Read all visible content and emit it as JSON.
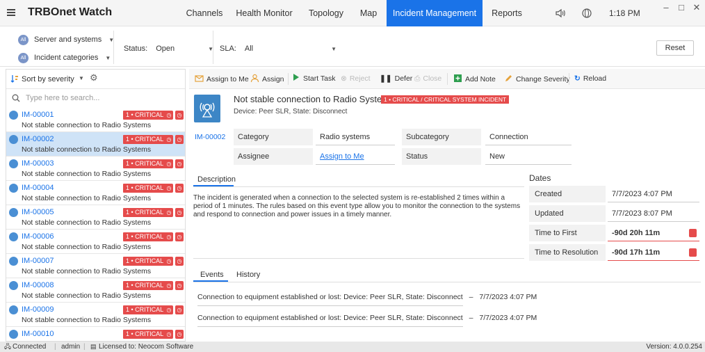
{
  "app": {
    "title": "TRBOnet Watch",
    "clock": "1:18 PM"
  },
  "nav": {
    "tabs": [
      {
        "label": "Channels"
      },
      {
        "label": "Health Monitor"
      },
      {
        "label": "Topology"
      },
      {
        "label": "Map"
      },
      {
        "label": "Incident Management"
      },
      {
        "label": "Reports"
      }
    ],
    "active": "Incident Management"
  },
  "filters": {
    "all_badge": "All",
    "scope_label": "Server and systems",
    "category_label": "Incident categories",
    "status_label": "Status:",
    "status_value": "Open",
    "sla_label": "SLA:",
    "sla_value": "All",
    "reset_label": "Reset"
  },
  "list": {
    "sort_label": "Sort by severity",
    "search_placeholder": "Type here to search...",
    "items": [
      {
        "id": "IM-00001",
        "severity": "1 • CRITICAL",
        "desc": "Not stable connection to Radio Systems"
      },
      {
        "id": "IM-00002",
        "severity": "1 • CRITICAL",
        "desc": "Not stable connection to Radio Systems"
      },
      {
        "id": "IM-00003",
        "severity": "1 • CRITICAL",
        "desc": "Not stable connection to Radio Systems"
      },
      {
        "id": "IM-00004",
        "severity": "1 • CRITICAL",
        "desc": "Not stable connection to Radio Systems"
      },
      {
        "id": "IM-00005",
        "severity": "1 • CRITICAL",
        "desc": "Not stable connection to Radio Systems"
      },
      {
        "id": "IM-00006",
        "severity": "1 • CRITICAL",
        "desc": "Not stable connection to Radio Systems"
      },
      {
        "id": "IM-00007",
        "severity": "1 • CRITICAL",
        "desc": "Not stable connection to Radio Systems"
      },
      {
        "id": "IM-00008",
        "severity": "1 • CRITICAL",
        "desc": "Not stable connection to Radio Systems"
      },
      {
        "id": "IM-00009",
        "severity": "1 • CRITICAL",
        "desc": "Not stable connection to Radio Systems"
      },
      {
        "id": "IM-00010",
        "severity": "1 • CRITICAL",
        "desc": ""
      }
    ]
  },
  "toolbar": {
    "assign_to_me": "Assign to Me",
    "assign": "Assign",
    "start_task": "Start Task",
    "reject": "Reject",
    "defer": "Defer",
    "close": "Close",
    "add_note": "Add Note",
    "change_severity": "Change Severity",
    "reload": "Reload"
  },
  "detail": {
    "title": "Not stable connection to Radio Systems",
    "severity_badge": "1 • CRITICAL / CRITICAL SYSTEM INCIDENT",
    "subtitle": "Device: Peer SLR, State: Disconnect",
    "id": "IM-00002",
    "category_label": "Category",
    "category_value": "Radio systems",
    "subcategory_label": "Subcategory",
    "subcategory_value": "Connection",
    "assignee_label": "Assignee",
    "assignee_value": "Assign to Me",
    "status_label": "Status",
    "status_value": "New",
    "description_tab": "Description",
    "description_text": "The incident is generated when a connection to the selected system is re-established 2 times within a period of 1 minutes. The rules based on this event type allow you to monitor the connection to the systems and respond to connection and power issues in a timely manner.",
    "dates_title": "Dates",
    "created_label": "Created",
    "created_value": "7/7/2023 4:07 PM",
    "updated_label": "Updated",
    "updated_value": "7/7/2023 8:07 PM",
    "first_reaction_label": "Time to First Reaction",
    "first_reaction_value": "-90d 20h 11m",
    "resolution_label": "Time to Resolution",
    "resolution_value": "-90d 17h 11m",
    "events_tab": "Events",
    "history_tab": "History",
    "events": [
      {
        "text": "Connection to equipment established or lost: Device: Peer SLR, State: Disconnect",
        "time": "7/7/2023 4:07 PM"
      },
      {
        "text": "Connection to equipment established or lost: Device: Peer SLR, State: Disconnect",
        "time": "7/7/2023 4:07 PM"
      }
    ]
  },
  "status": {
    "connected": "Connected",
    "user": "admin",
    "license": "Licensed to: Neocom Software",
    "version": "Version: 4.0.0.254"
  },
  "colors": {
    "accent": "#1a73e8",
    "critical": "#e54b4b",
    "selected_row": "#cfe3f7"
  }
}
